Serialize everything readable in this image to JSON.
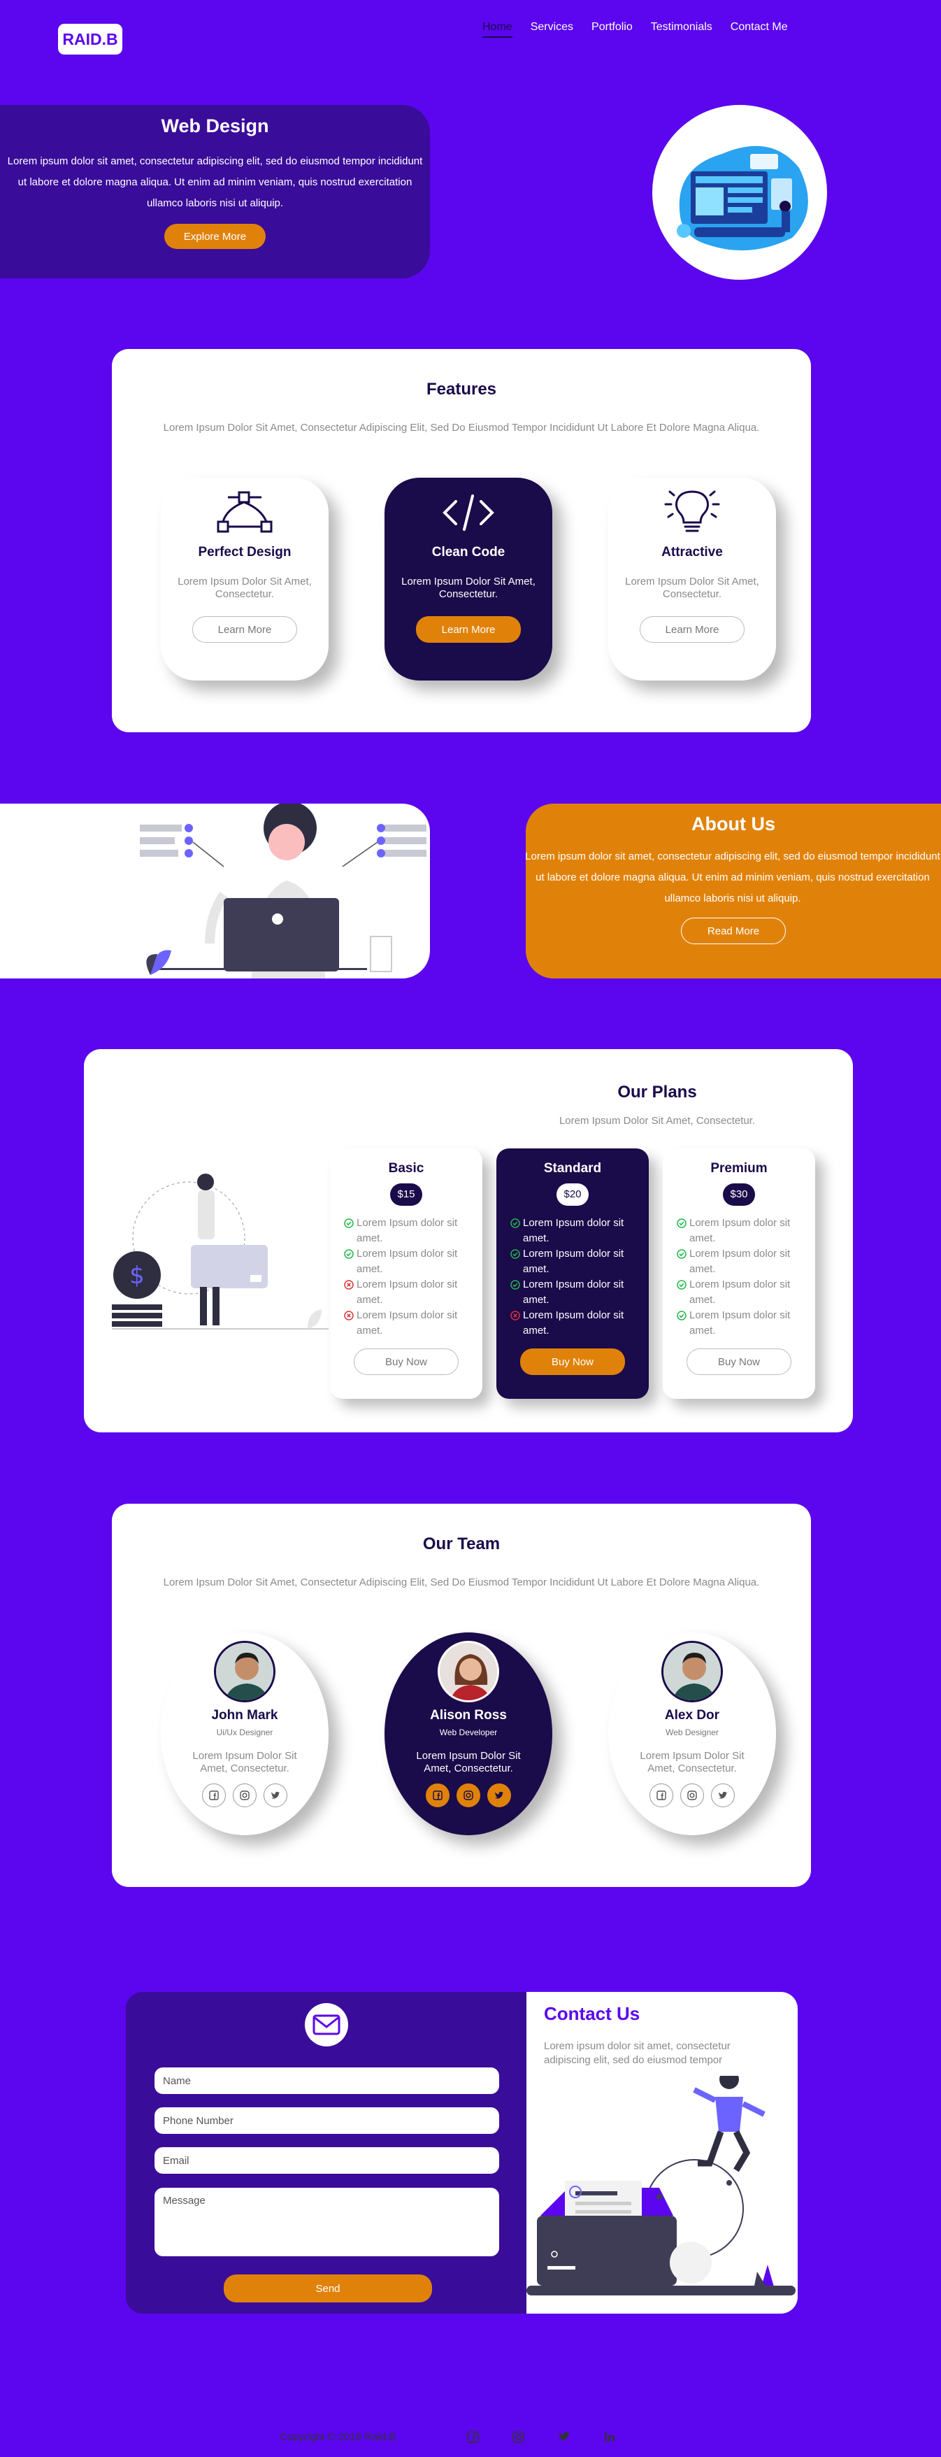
{
  "header": {
    "logo": "RAID.B",
    "nav": [
      "Home",
      "Services",
      "Portfolio",
      "Testimonials",
      "Contact Me"
    ]
  },
  "hero": {
    "title": "Web Design",
    "text": "Lorem ipsum dolor sit amet, consectetur adipiscing elit, sed do eiusmod tempor incididunt ut labore et dolore magna aliqua. Ut enim ad minim veniam, quis nostrud exercitation ullamco laboris nisi ut aliquip.",
    "button": "Explore More"
  },
  "features": {
    "title": "Features",
    "subtitle": "Lorem Ipsum Dolor Sit Amet, Consectetur Adipiscing Elit, Sed Do Eiusmod Tempor Incididunt Ut Labore Et Dolore Magna Aliqua.",
    "cards": [
      {
        "title": "Perfect Design",
        "text": "Lorem Ipsum Dolor Sit Amet, Consectetur.",
        "button": "Learn More",
        "icon": "vector-pen-icon"
      },
      {
        "title": "Clean Code",
        "text": "Lorem Ipsum Dolor Sit Amet, Consectetur.",
        "button": "Learn More",
        "icon": "code-icon"
      },
      {
        "title": "Attractive",
        "text": "Lorem Ipsum Dolor Sit Amet, Consectetur.",
        "button": "Learn More",
        "icon": "lightbulb-icon"
      }
    ]
  },
  "about": {
    "title": "About Us",
    "text": "Lorem ipsum dolor sit amet, consectetur adipiscing elit, sed do eiusmod tempor incididunt ut labore et dolore magna aliqua. Ut enim ad minim veniam, quis nostrud exercitation ullamco laboris nisi ut aliquip.",
    "button": "Read More"
  },
  "plans": {
    "title": "Our Plans",
    "subtitle": "Lorem Ipsum Dolor Sit Amet, Consectetur.",
    "item_text": "Lorem Ipsum dolor sit amet.",
    "cards": [
      {
        "name": "Basic",
        "price": "$15",
        "button": "Buy Now",
        "checks": [
          true,
          true,
          false,
          false
        ]
      },
      {
        "name": "Standard",
        "price": "$20",
        "button": "Buy Now",
        "checks": [
          true,
          true,
          true,
          false
        ]
      },
      {
        "name": "Premium",
        "price": "$30",
        "button": "Buy Now",
        "checks": [
          true,
          true,
          true,
          true
        ]
      }
    ]
  },
  "team": {
    "title": "Our Team",
    "subtitle": "Lorem Ipsum Dolor Sit Amet, Consectetur Adipiscing Elit, Sed Do Eiusmod Tempor Incididunt Ut Labore Et Dolore Magna Aliqua.",
    "members": [
      {
        "name": "John Mark",
        "role": "Ui/Ux Designer",
        "text": "Lorem Ipsum Dolor Sit Amet, Consectetur."
      },
      {
        "name": "Alison Ross",
        "role": "Web Developer",
        "text": "Lorem Ipsum Dolor Sit Amet, Consectetur."
      },
      {
        "name": "Alex Dor",
        "role": "Web Designer",
        "text": "Lorem Ipsum Dolor Sit Amet, Consectetur."
      }
    ]
  },
  "contact": {
    "title": "Contact Us",
    "text": "Lorem ipsum dolor sit amet, consectetur adipiscing elit, sed do eiusmod tempor",
    "placeholders": {
      "name": "Name",
      "phone": "Phone Number",
      "email": "Email",
      "message": "Message"
    },
    "button": "Send"
  },
  "footer": {
    "copyright": "Copyright © 2019 Raid.B"
  },
  "colors": {
    "background": "#5b06ee",
    "dark": "#1a0b4a",
    "accent": "#e0820a",
    "hero_card": "#3a0c9a"
  }
}
